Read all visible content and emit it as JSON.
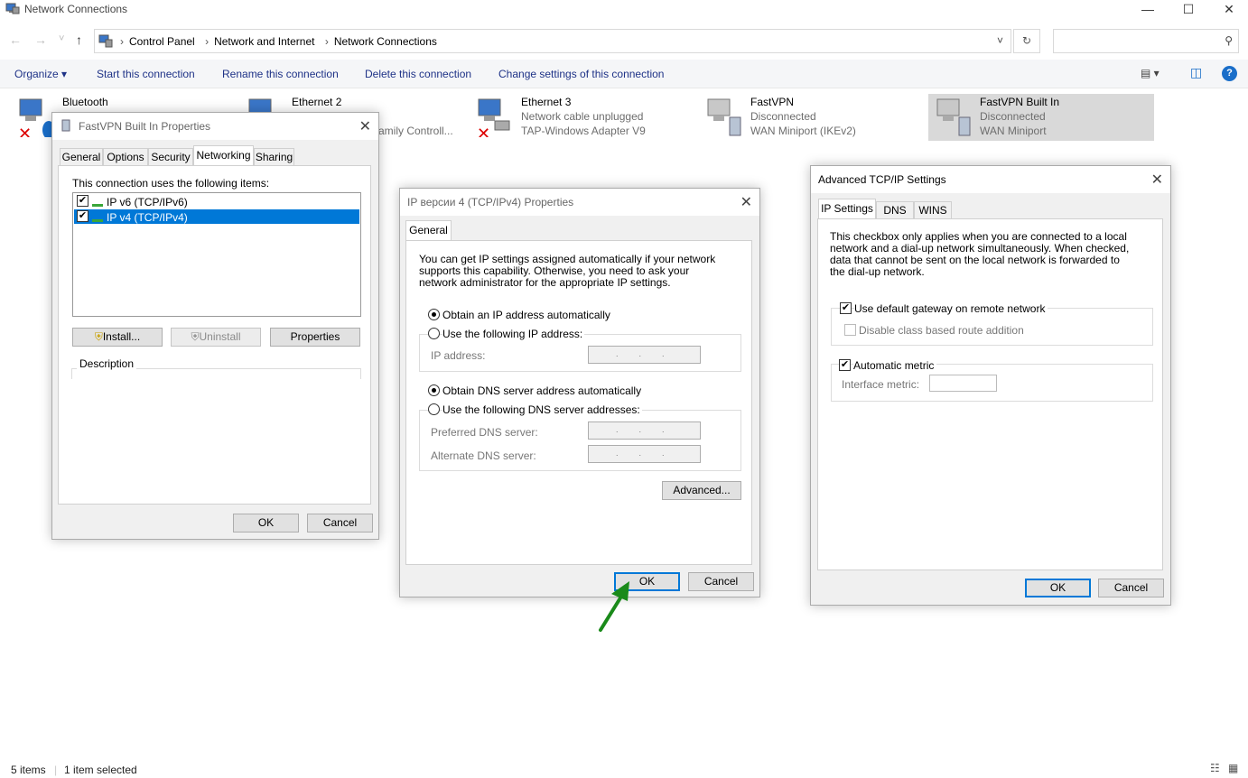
{
  "window": {
    "title": "Network Connections",
    "minimize": "—",
    "maximize": "☐",
    "close": "✕"
  },
  "address": {
    "back": "←",
    "forward": "→",
    "recent": "˅",
    "up": "↑",
    "crumbs": [
      "Control Panel",
      "Network and Internet",
      "Network Connections"
    ],
    "dropdown": "˅",
    "refresh": "↻",
    "search_placeholder": "",
    "search_icon": "⚲"
  },
  "commands": {
    "organize": "Organize ▾",
    "start": "Start this connection",
    "rename": "Rename this connection",
    "delete": "Delete this connection",
    "change": "Change settings of this connection",
    "view_icon": "▤ ▾",
    "pane_icon": "◫",
    "help": "?"
  },
  "connections": [
    {
      "name": "Bluetooth",
      "line2": "",
      "line3": ""
    },
    {
      "name": "Ethernet 2",
      "line2": "",
      "line3": "amily Controll..."
    },
    {
      "name": "Ethernet 3",
      "line2": "Network cable unplugged",
      "line3": "TAP-Windows Adapter V9"
    },
    {
      "name": "FastVPN",
      "line2": "Disconnected",
      "line3": "WAN Miniport (IKEv2)"
    },
    {
      "name": "FastVPN Built In",
      "line2": "Disconnected",
      "line3": "WAN Miniport"
    }
  ],
  "props_dialog": {
    "title": "FastVPN Built In Properties",
    "tabs": [
      "General",
      "Options",
      "Security",
      "Networking",
      "Sharing"
    ],
    "uses_label": "This connection uses the following items:",
    "items": [
      {
        "label": "IP v6 (TCP/IPv6)",
        "checked": "✔"
      },
      {
        "label": "IP v4 (TCP/IPv4)",
        "checked": "✔"
      }
    ],
    "install": "Install...",
    "uninstall": "Uninstall",
    "properties": "Properties",
    "description": "Description",
    "ok": "OK",
    "cancel": "Cancel"
  },
  "ipv4_dialog": {
    "title": "IP версии 4 (TCP/IPv4) Properties",
    "tab": "General",
    "intro": "You can get IP settings assigned automatically if your network supports this capability. Otherwise, you need to ask your network administrator for the appropriate IP settings.",
    "obtain_ip": "Obtain an IP address automatically",
    "use_ip": "Use the following IP address:",
    "ip_label": "IP address:",
    "obtain_dns": "Obtain DNS server address automatically",
    "use_dns": "Use the following DNS server addresses:",
    "preferred_dns": "Preferred DNS server:",
    "alternate_dns": "Alternate DNS server:",
    "ip_dots": "...",
    "advanced": "Advanced...",
    "ok": "OK",
    "cancel": "Cancel"
  },
  "advanced_dialog": {
    "title": "Advanced TCP/IP Settings",
    "tabs": [
      "IP Settings",
      "DNS",
      "WINS"
    ],
    "info": "This checkbox only applies when you are connected to a local network and a dial-up network simultaneously.  When checked, data that cannot be sent on the local network is forwarded to the dial-up network.",
    "use_gateway": "Use default gateway on remote network",
    "disable_class": "Disable class based route addition",
    "auto_metric": "Automatic metric",
    "interface_metric": "Interface metric:",
    "checkmark": "✔",
    "ok": "OK",
    "cancel": "Cancel"
  },
  "status": {
    "items": "5 items",
    "selected": "1 item selected"
  },
  "colors": {
    "selection_blue": "#0078d7",
    "arrow_green": "#1a8a1a"
  }
}
